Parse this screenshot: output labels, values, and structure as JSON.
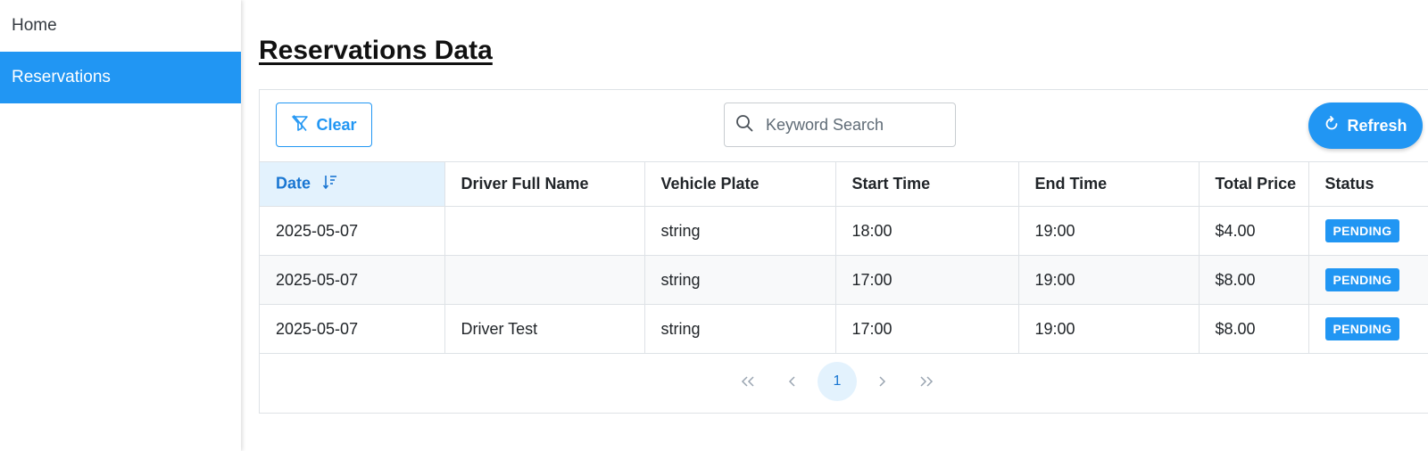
{
  "sidebar": {
    "items": [
      {
        "label": "Home",
        "active": false
      },
      {
        "label": "Reservations",
        "active": true
      }
    ]
  },
  "page": {
    "title": "Reservations Data"
  },
  "toolbar": {
    "clear_label": "Clear",
    "clear_icon": "filter-slash-icon",
    "search_placeholder": "Keyword Search",
    "search_value": "",
    "search_icon": "search-icon",
    "refresh_label": "Refresh",
    "refresh_icon": "refresh-icon"
  },
  "table": {
    "columns": [
      "Date",
      "Driver Full Name",
      "Vehicle Plate",
      "Start Time",
      "End Time",
      "Total Price",
      "Status"
    ],
    "sorted_column": "Date",
    "rows": [
      [
        "2025-05-07",
        "",
        "string",
        "18:00",
        "19:00",
        "$4.00",
        "PENDING"
      ],
      [
        "2025-05-07",
        "",
        "string",
        "17:00",
        "19:00",
        "$8.00",
        "PENDING"
      ],
      [
        "2025-05-07",
        "Driver Test",
        "string",
        "17:00",
        "19:00",
        "$8.00",
        "PENDING"
      ]
    ]
  },
  "pagination": {
    "first_icon": "double-chevron-left-icon",
    "prev_icon": "chevron-left-icon",
    "current_page": "1",
    "next_icon": "chevron-right-icon",
    "last_icon": "double-chevron-right-icon"
  },
  "colors": {
    "accent": "#2196f3",
    "sorted_header_bg": "#e3f2fd",
    "sorted_header_text": "#1976d2",
    "status_badge": "#2196f3"
  }
}
